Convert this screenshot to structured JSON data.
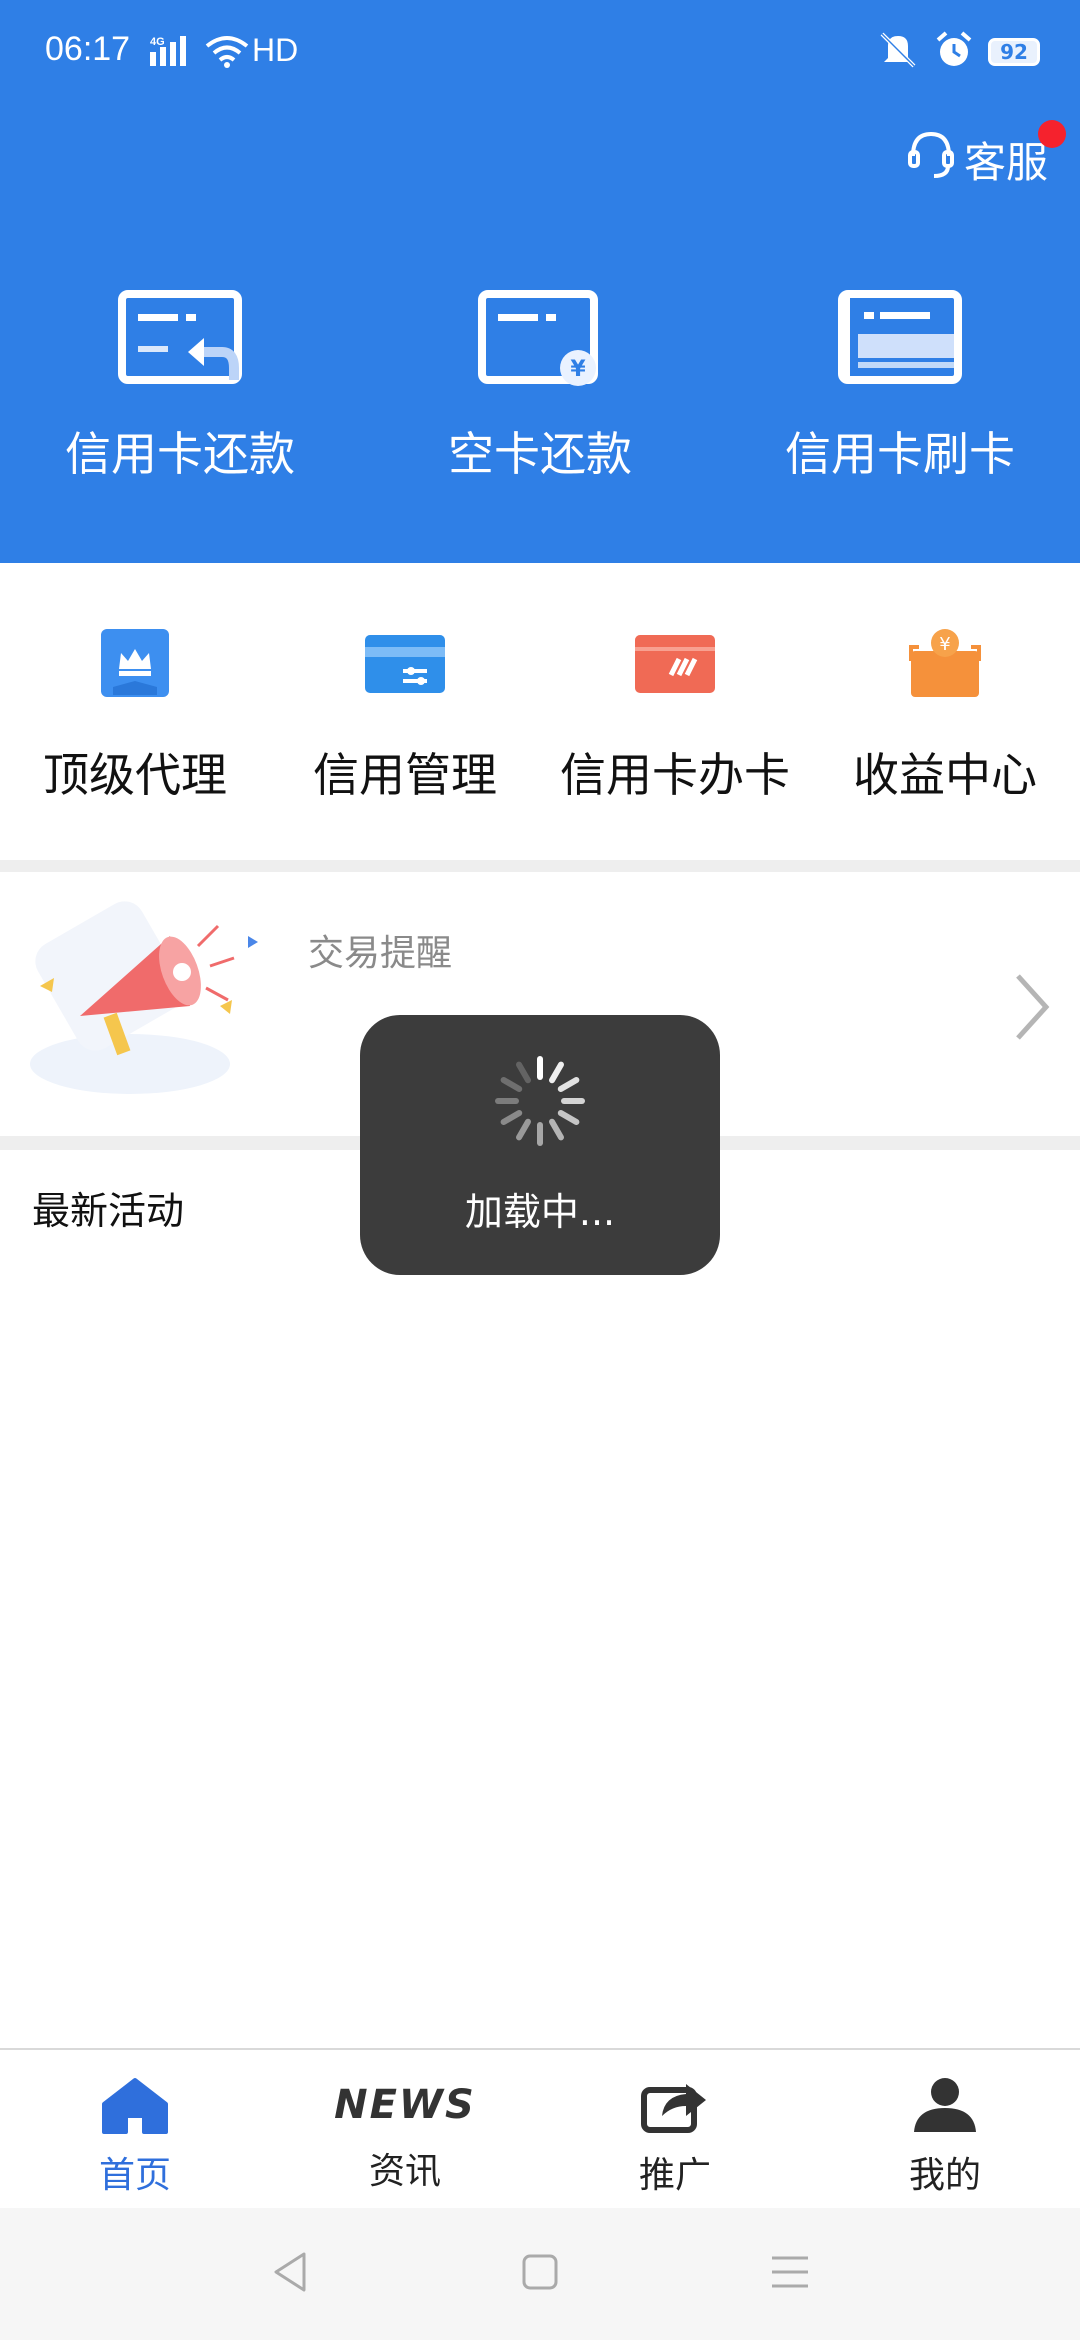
{
  "status_bar": {
    "time": "06:17",
    "network": "4G",
    "hd": "HD",
    "battery": "92"
  },
  "header": {
    "service_label": "客服",
    "quick_actions": [
      {
        "label": "信用卡还款",
        "icon": "card-repay-icon"
      },
      {
        "label": "空卡还款",
        "icon": "card-yuan-icon"
      },
      {
        "label": "信用卡刷卡",
        "icon": "card-swipe-icon"
      }
    ]
  },
  "grid": [
    {
      "label": "顶级代理",
      "icon": "crown-icon",
      "color": "#3d8ff0"
    },
    {
      "label": "信用管理",
      "icon": "card-settings-icon",
      "color": "#2f8fea"
    },
    {
      "label": "信用卡办卡",
      "icon": "card-apply-icon",
      "color": "#f06a55"
    },
    {
      "label": "收益中心",
      "icon": "income-box-icon",
      "color": "#f5913b"
    }
  ],
  "notice": {
    "title": "交易提醒",
    "illustration": "megaphone-icon"
  },
  "latest": {
    "title": "最新活动"
  },
  "loading": {
    "text": "加载中..."
  },
  "tabbar": [
    {
      "label": "首页",
      "icon": "home-icon",
      "active": true
    },
    {
      "label": "资讯",
      "icon": "news-icon",
      "icon_text": "NEWS",
      "active": false
    },
    {
      "label": "推广",
      "icon": "share-icon",
      "active": false
    },
    {
      "label": "我的",
      "icon": "user-icon",
      "active": false
    }
  ],
  "colors": {
    "primary": "#2f7fe6",
    "active_tab": "#2f6fdc",
    "badge": "#f5222d"
  }
}
